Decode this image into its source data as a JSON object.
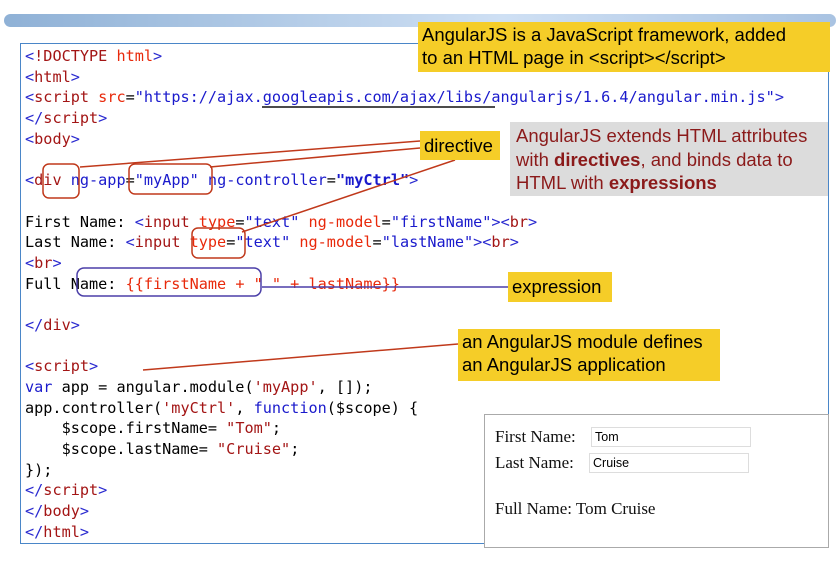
{
  "code_lines": [
    [
      [
        "<",
        "b"
      ],
      [
        "!DOCTYPE ",
        "t"
      ],
      [
        "html",
        "a"
      ],
      [
        ">",
        "b"
      ]
    ],
    [
      [
        "<",
        "b"
      ],
      [
        "html",
        "t"
      ],
      [
        ">",
        "b"
      ]
    ],
    [
      [
        "<",
        "b"
      ],
      [
        "script ",
        "t"
      ],
      [
        "src",
        "a"
      ],
      [
        "=",
        "p"
      ],
      [
        "\"https://ajax.googleapis.com/ajax/libs/angularjs/1.6.4/angular.min.js\"",
        "v"
      ],
      [
        ">",
        "b"
      ]
    ],
    [
      [
        "</",
        "b"
      ],
      [
        "script",
        "t"
      ],
      [
        ">",
        "b"
      ]
    ],
    [
      [
        "<",
        "b"
      ],
      [
        "body",
        "t"
      ],
      [
        ">",
        "b"
      ]
    ],
    [],
    [
      [
        "<",
        "b"
      ],
      [
        "div ",
        "t"
      ],
      [
        "ng-app",
        "v"
      ],
      [
        "=",
        "p"
      ],
      [
        "\"myApp\" ",
        "v"
      ],
      [
        "ng-controller",
        "v"
      ],
      [
        "=",
        "p"
      ],
      [
        "\"myCtrl\"",
        "vb"
      ],
      [
        ">",
        "b"
      ]
    ],
    [],
    [
      [
        "First Name: ",
        "p"
      ],
      [
        "<",
        "b"
      ],
      [
        "input ",
        "t"
      ],
      [
        "type",
        "a"
      ],
      [
        "=",
        "p"
      ],
      [
        "\"text\" ",
        "v"
      ],
      [
        "ng-model",
        "a"
      ],
      [
        "=",
        "p"
      ],
      [
        "\"firstName\"",
        "v"
      ],
      [
        "><",
        "b"
      ],
      [
        "br",
        "t"
      ],
      [
        ">",
        "b"
      ]
    ],
    [
      [
        "Last Name: ",
        "p"
      ],
      [
        "<",
        "b"
      ],
      [
        "input ",
        "t"
      ],
      [
        "type",
        "a"
      ],
      [
        "=",
        "p"
      ],
      [
        "\"text\" ",
        "v"
      ],
      [
        "ng-model",
        "a"
      ],
      [
        "=",
        "p"
      ],
      [
        "\"lastName\"",
        "v"
      ],
      [
        "><",
        "b"
      ],
      [
        "br",
        "t"
      ],
      [
        ">",
        "b"
      ]
    ],
    [
      [
        "<",
        "b"
      ],
      [
        "br",
        "t"
      ],
      [
        ">",
        "b"
      ]
    ],
    [
      [
        "Full Name: ",
        "p"
      ],
      [
        "{{firstName + \" \" + lastName}}",
        "e"
      ]
    ],
    [],
    [
      [
        "</",
        "b"
      ],
      [
        "div",
        "t"
      ],
      [
        ">",
        "b"
      ]
    ],
    [],
    [
      [
        "<",
        "b"
      ],
      [
        "script",
        "t"
      ],
      [
        ">",
        "b"
      ]
    ],
    [
      [
        "var ",
        "k"
      ],
      [
        "app = angular.module(",
        "p"
      ],
      [
        "'myApp'",
        "s"
      ],
      [
        ", []);",
        "p"
      ]
    ],
    [
      [
        "app.controller(",
        "p"
      ],
      [
        "'myCtrl'",
        "s"
      ],
      [
        ", ",
        "p"
      ],
      [
        "function",
        "k"
      ],
      [
        "($scope) {",
        "p"
      ]
    ],
    [
      [
        "    $scope.firstName= ",
        "p"
      ],
      [
        "\"Tom\"",
        "s"
      ],
      [
        ";",
        "p"
      ]
    ],
    [
      [
        "    $scope.lastName= ",
        "p"
      ],
      [
        "\"Cruise\"",
        "s"
      ],
      [
        ";",
        "p"
      ]
    ],
    [
      [
        "});",
        "p"
      ]
    ],
    [
      [
        "</",
        "b"
      ],
      [
        "script",
        "t"
      ],
      [
        ">",
        "b"
      ]
    ],
    [
      [
        "</",
        "b"
      ],
      [
        "body",
        "t"
      ],
      [
        ">",
        "b"
      ]
    ],
    [
      [
        "</",
        "b"
      ],
      [
        "html",
        "t"
      ],
      [
        ">",
        "b"
      ]
    ]
  ],
  "notes": {
    "intro_line1": "AngularJS is a JavaScript framework, added",
    "intro_line2": "to an HTML page in <script></script>",
    "directive": "directive",
    "extends_1": "AngularJS extends HTML attributes",
    "extends_2a": "with ",
    "extends_2b": "directives",
    "extends_2c": ", and binds data to",
    "extends_3a": "HTML with ",
    "extends_3b": "expressions",
    "expression": "expression",
    "module_line1": "an AngularJS module defines",
    "module_line2": "an AngularJS application"
  },
  "result": {
    "first_label": "First Name:",
    "first_value": "Tom",
    "last_label": "Last Name:",
    "last_value": "Cruise",
    "full_label": "Full Name:",
    "full_value": "Tom Cruise"
  },
  "colors": {
    "callout": "#f5cd28",
    "annotation_red": "#c0391b",
    "annotation_blue": "#4b3fa8",
    "border": "#4a86c8"
  }
}
